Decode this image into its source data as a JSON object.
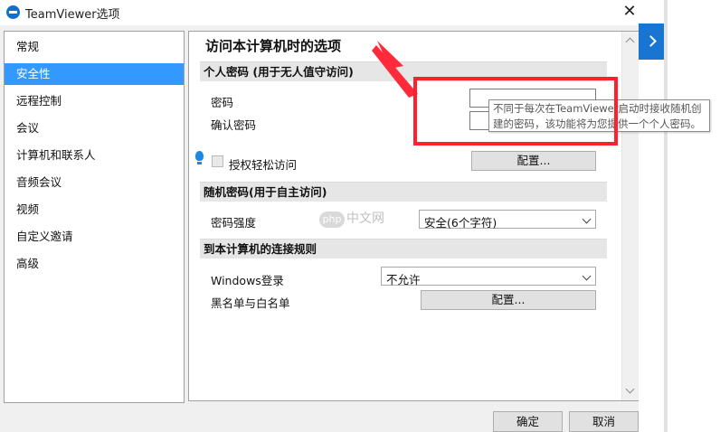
{
  "window": {
    "title": "TeamViewer选项",
    "close_glyph": "✕"
  },
  "sidebar": {
    "items": [
      {
        "label": "常规"
      },
      {
        "label": "安全性",
        "selected": true
      },
      {
        "label": "远程控制"
      },
      {
        "label": "会议"
      },
      {
        "label": "计算机和联系人"
      },
      {
        "label": "音频会议"
      },
      {
        "label": "视频"
      },
      {
        "label": "自定义邀请"
      },
      {
        "label": "高级"
      }
    ]
  },
  "panel": {
    "title": "访问本计算机时的选项",
    "personal_password": {
      "header": "个人密码 (用于无人值守访问)",
      "password_label": "密码",
      "password_value": "",
      "confirm_label": "确认密码",
      "confirm_value": "",
      "easy_access_label": "授权轻松访问",
      "easy_access_checked": false,
      "configure_button": "配置..."
    },
    "random_password": {
      "header": "随机密码(用于自主访问)",
      "strength_label": "密码强度",
      "strength_value": "安全(6个字符)"
    },
    "connection_rules": {
      "header": "到本计算机的连接规则",
      "windows_login_label": "Windows登录",
      "windows_login_value": "不允许",
      "blacklist_label": "黑名单与白名单",
      "blacklist_button": "配置..."
    }
  },
  "tooltip": {
    "line1": "不同于每次在TeamViewer启动时接收随机创",
    "line2": "建的密码，该功能将为您提供一个个人密码。"
  },
  "watermark": {
    "logo": "php",
    "text": "中文网"
  },
  "footer": {
    "ok_button": "确定",
    "cancel_button": "取消"
  },
  "colors": {
    "selection": "#3399ff",
    "annotation": "#ff1f2e",
    "brand": "#0e6fd6"
  }
}
